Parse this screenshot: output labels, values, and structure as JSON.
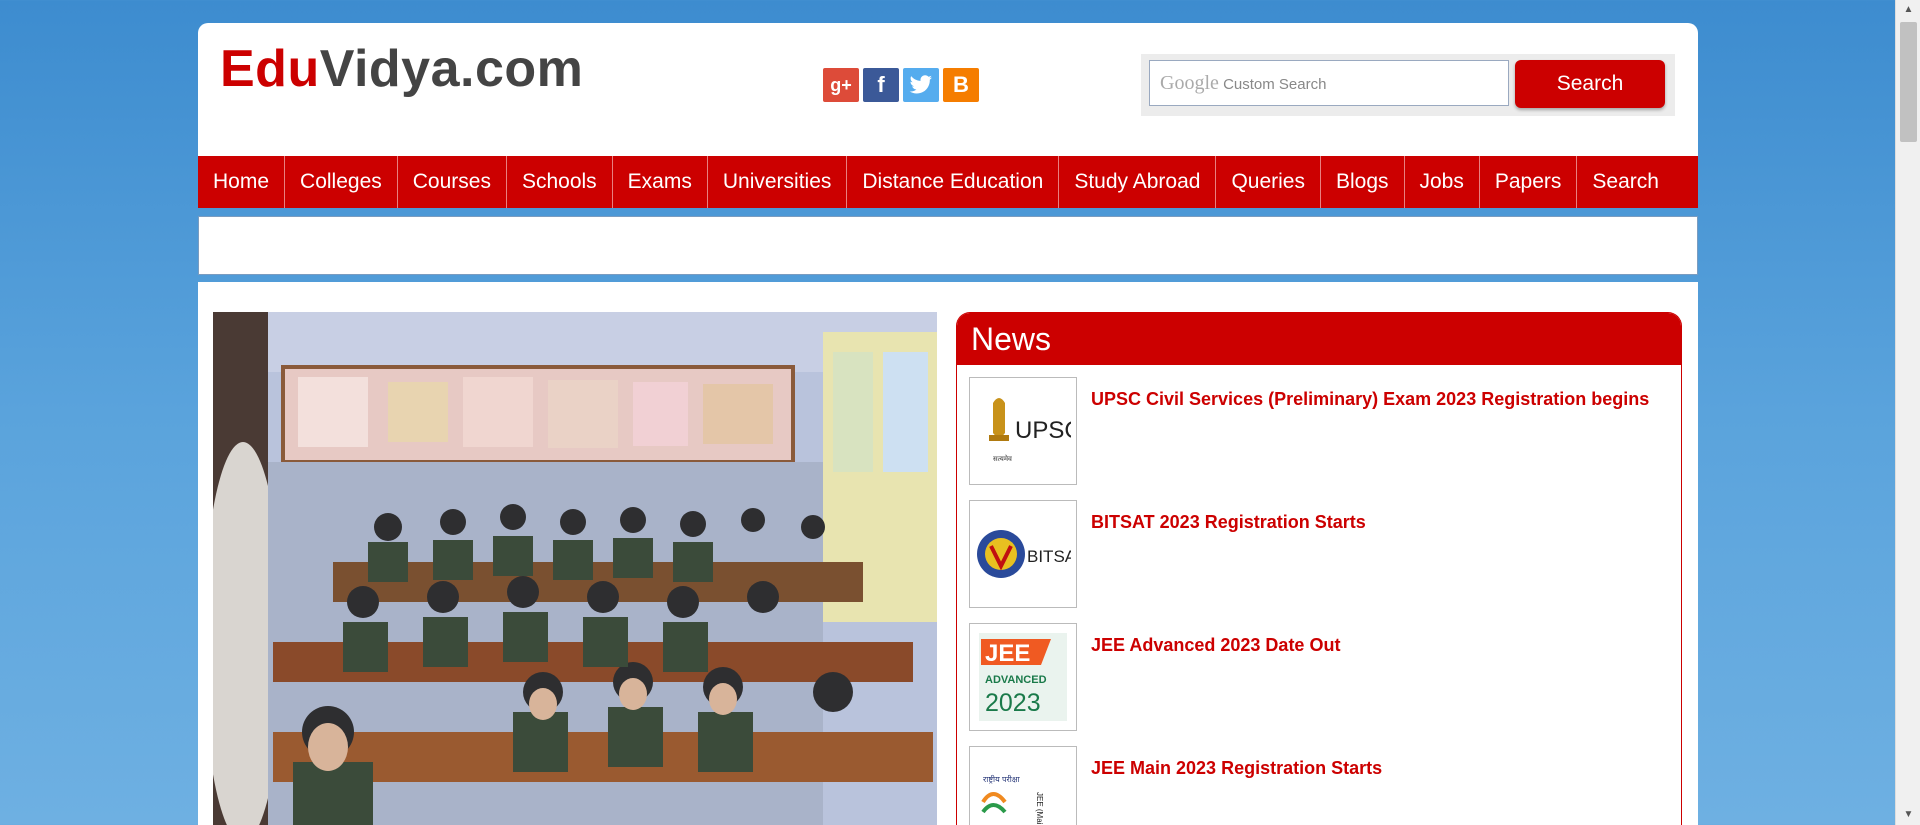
{
  "logo": {
    "part1": "Edu",
    "part2": "Vidya.com"
  },
  "social": [
    {
      "icon": "google-plus-icon",
      "glyph": "g+"
    },
    {
      "icon": "facebook-icon",
      "glyph": "f"
    },
    {
      "icon": "twitter-icon",
      "glyph": "t"
    },
    {
      "icon": "blogger-icon",
      "glyph": "B"
    }
  ],
  "search": {
    "brand": "Google",
    "placeholder": "Custom Search",
    "button_label": "Search"
  },
  "nav": [
    "Home",
    "Colleges",
    "Courses",
    "Schools",
    "Exams",
    "Universities",
    "Distance Education",
    "Study Abroad",
    "Queries",
    "Blogs",
    "Jobs",
    "Papers",
    "Search"
  ],
  "news": {
    "heading": "News",
    "items": [
      {
        "title": "UPSC Civil Services (Preliminary) Exam 2023 Registration begins",
        "thumb": "UPSC"
      },
      {
        "title": "BITSAT 2023 Registration Starts",
        "thumb": "BITSAT"
      },
      {
        "title": "JEE Advanced 2023 Date Out",
        "thumb_top": "JEE",
        "thumb_mid": "ADVANCED",
        "thumb_bot": "2023"
      },
      {
        "title": "JEE Main 2023 Registration Starts",
        "thumb": "JEE (Main)"
      }
    ]
  },
  "colors": {
    "brand_red": "#cc0000",
    "logo_gray": "#444444"
  }
}
